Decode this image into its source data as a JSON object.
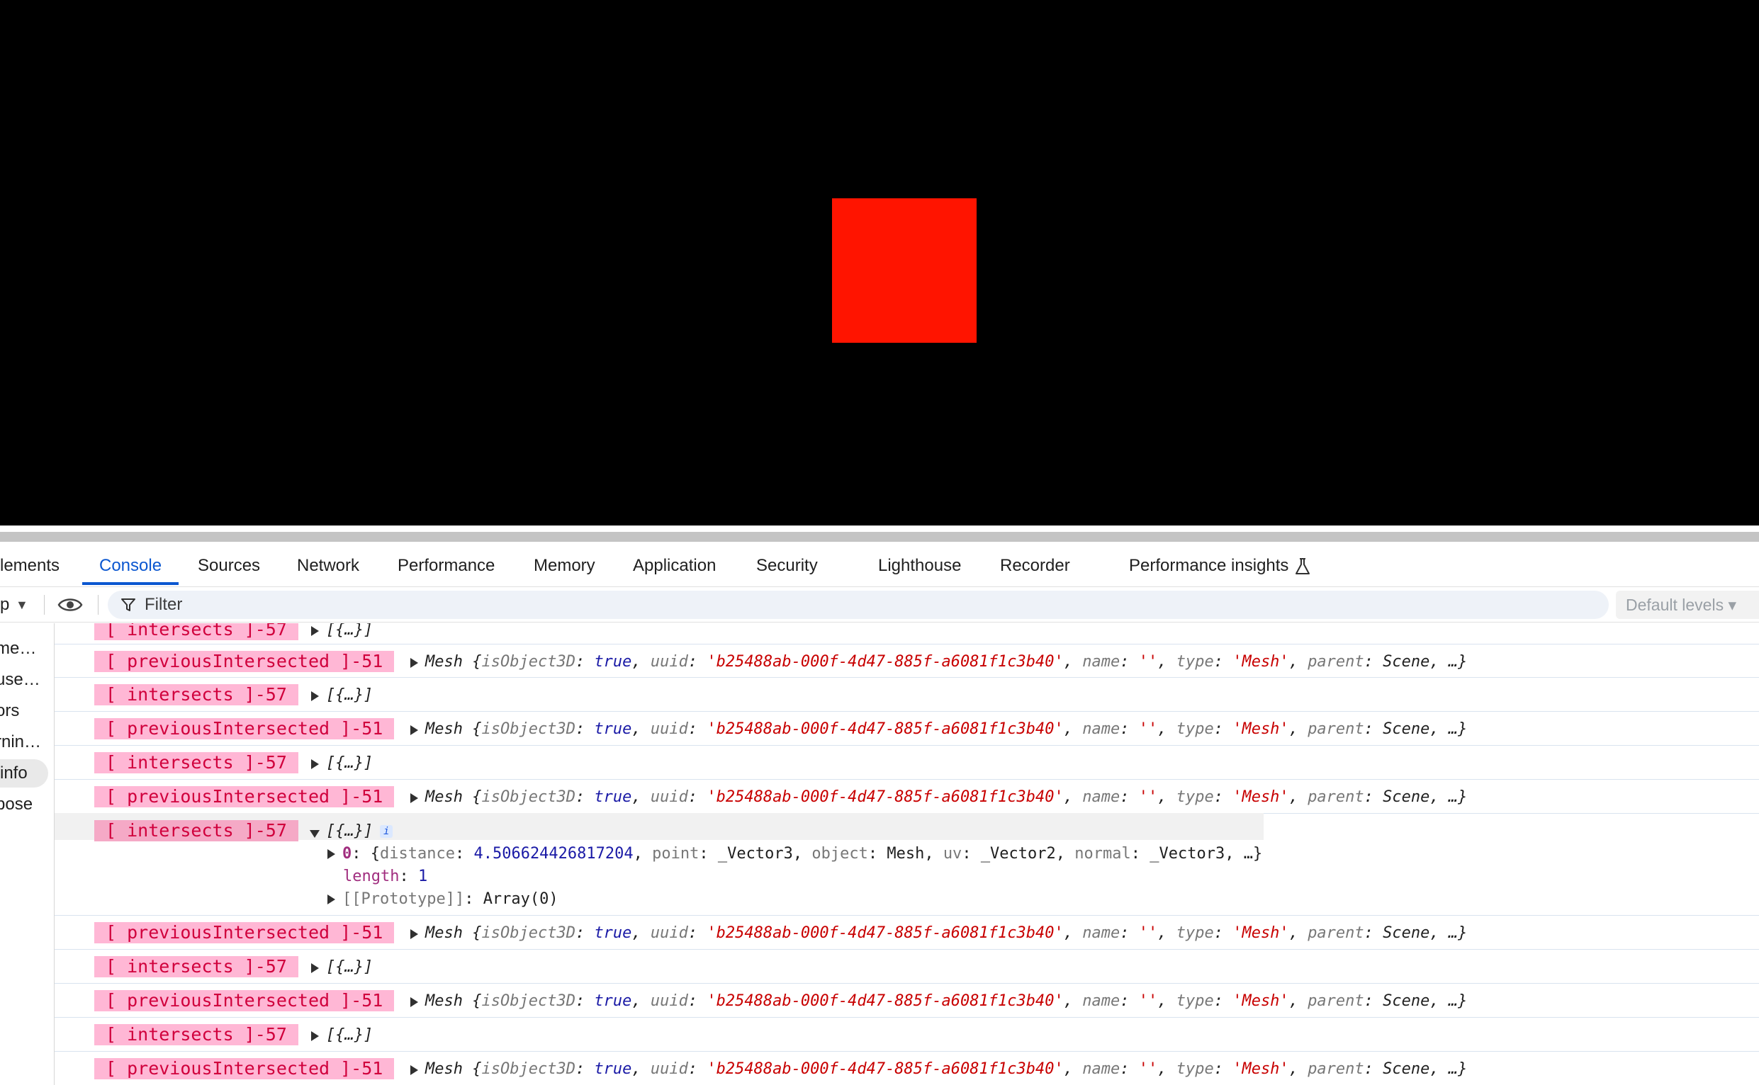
{
  "devtools": {
    "tabs": [
      {
        "label": "lements"
      },
      {
        "label": "Console"
      },
      {
        "label": "Sources"
      },
      {
        "label": "Network"
      },
      {
        "label": "Performance"
      },
      {
        "label": "Memory"
      },
      {
        "label": "Application"
      },
      {
        "label": "Security"
      },
      {
        "label": "Lighthouse"
      },
      {
        "label": "Recorder"
      },
      {
        "label": "Performance insights"
      }
    ],
    "active_tab": "Console"
  },
  "toolbar": {
    "context_label": "p",
    "filter_placeholder": "Filter",
    "levels_label": "Default levels ▾"
  },
  "sidebar": {
    "items": [
      {
        "label": "me…"
      },
      {
        "label": "use…"
      },
      {
        "label": "ors"
      },
      {
        "label": "rnin…"
      },
      {
        "label": "info"
      },
      {
        "label": "bose"
      }
    ],
    "selected_index": 4
  },
  "console": {
    "mesh_summary": {
      "prefix": "Mesh ",
      "open": "{",
      "k1": "isObject3D",
      "v1": "true",
      "k2": "uuid",
      "v2": "'b25488ab-000f-4d47-885f-a6081f1c3b40'",
      "k3": "name",
      "v3": "''",
      "k4": "type",
      "v4": "'Mesh'",
      "k5": "parent",
      "v5": "Scene, …}"
    },
    "array_summary": "[{…}]",
    "rows": [
      {
        "label": "[ intersects ]-57"
      },
      {
        "label": "[ previousIntersected ]-51"
      },
      {
        "label": "[ intersects ]-57"
      },
      {
        "label": "[ previousIntersected ]-51"
      },
      {
        "label": "[ intersects ]-57"
      },
      {
        "label": "[ previousIntersected ]-51"
      },
      {
        "label": "[ intersects ]-57"
      },
      {
        "label": "[ previousIntersected ]-51"
      },
      {
        "label": "[ intersects ]-57"
      },
      {
        "label": "[ previousIntersected ]-51"
      },
      {
        "label": "[ intersects ]-57"
      },
      {
        "label": "[ previousIntersected ]-51"
      }
    ],
    "expanded": {
      "info_badge": "i",
      "item0_key": "0",
      "item0_text": "{distance: 4.506624426817204, point: _Vector3, object: Mesh, uv: _Vector2, normal: _Vector3, …}",
      "item0_parts": {
        "k1": "distance",
        "v1": "4.506624426817204",
        "k2": "point",
        "v2": "_Vector3",
        "k3": "object",
        "v3": "Mesh",
        "k4": "uv",
        "v4": "_Vector2",
        "k5": "normal",
        "v5": "_Vector3, …}"
      },
      "length_key": "length",
      "length_value": "1",
      "prototype_key": "[[Prototype]]",
      "prototype_value": "Array(0)"
    }
  }
}
